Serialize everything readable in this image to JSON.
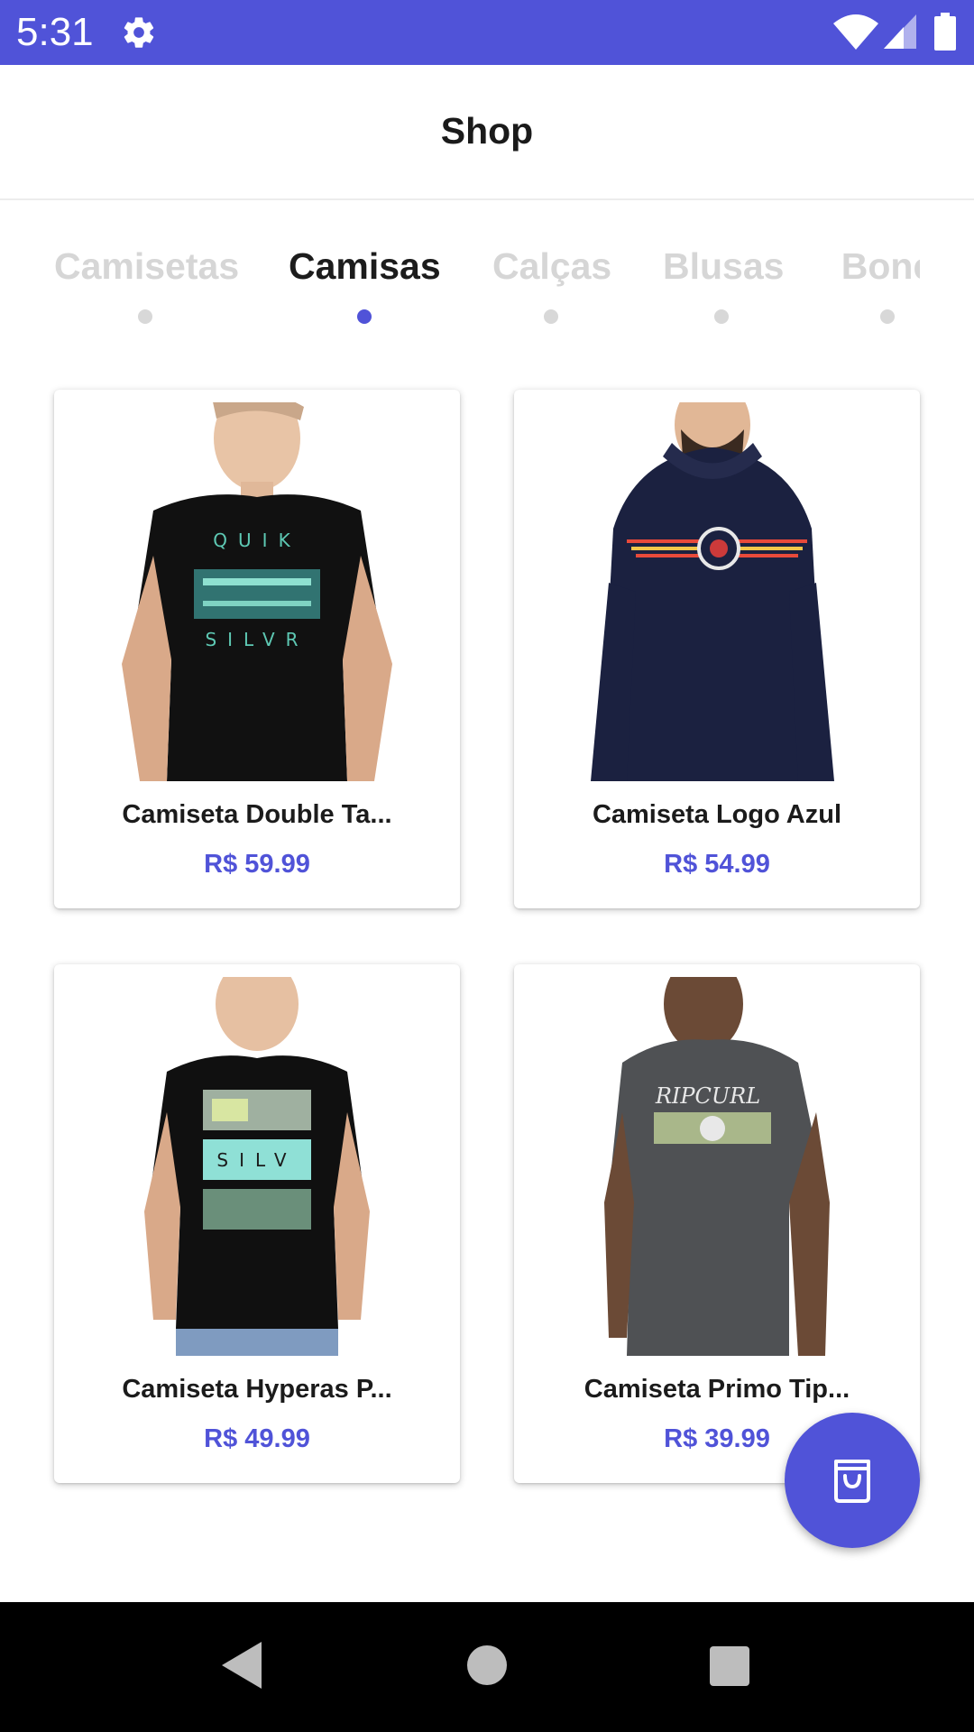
{
  "status_bar": {
    "time": "5:31",
    "icons": [
      "gear-icon",
      "wifi-icon",
      "signal-icon",
      "battery-icon"
    ],
    "background": "#5053d8"
  },
  "app_bar": {
    "title": "Shop"
  },
  "tabs": [
    {
      "label": "Camisetas",
      "active": false
    },
    {
      "label": "Camisas",
      "active": true
    },
    {
      "label": "Calças",
      "active": false
    },
    {
      "label": "Blusas",
      "active": false
    },
    {
      "label": "Boné",
      "active": false
    }
  ],
  "products": [
    {
      "name": "Camiseta Double Ta...",
      "price": "R$ 59.99",
      "image": "black-tshirt-graphic"
    },
    {
      "name": "Camiseta Logo Azul",
      "price": "R$ 54.99",
      "image": "navy-hoodie-logo"
    },
    {
      "name": "Camiseta Hyperas P...",
      "price": "R$ 49.99",
      "image": "black-tshirt-print"
    },
    {
      "name": "Camiseta Primo Tip...",
      "price": "R$ 39.99",
      "image": "grey-tshirt-ripcurl"
    }
  ],
  "fab": {
    "icon": "shopping-bag-icon"
  },
  "nav_bar": {
    "icons": [
      "back-icon",
      "home-icon",
      "recents-icon"
    ]
  },
  "colors": {
    "accent": "#5053d8",
    "tab_inactive": "#d6d6d6",
    "text_dark": "#1b1b1b"
  }
}
